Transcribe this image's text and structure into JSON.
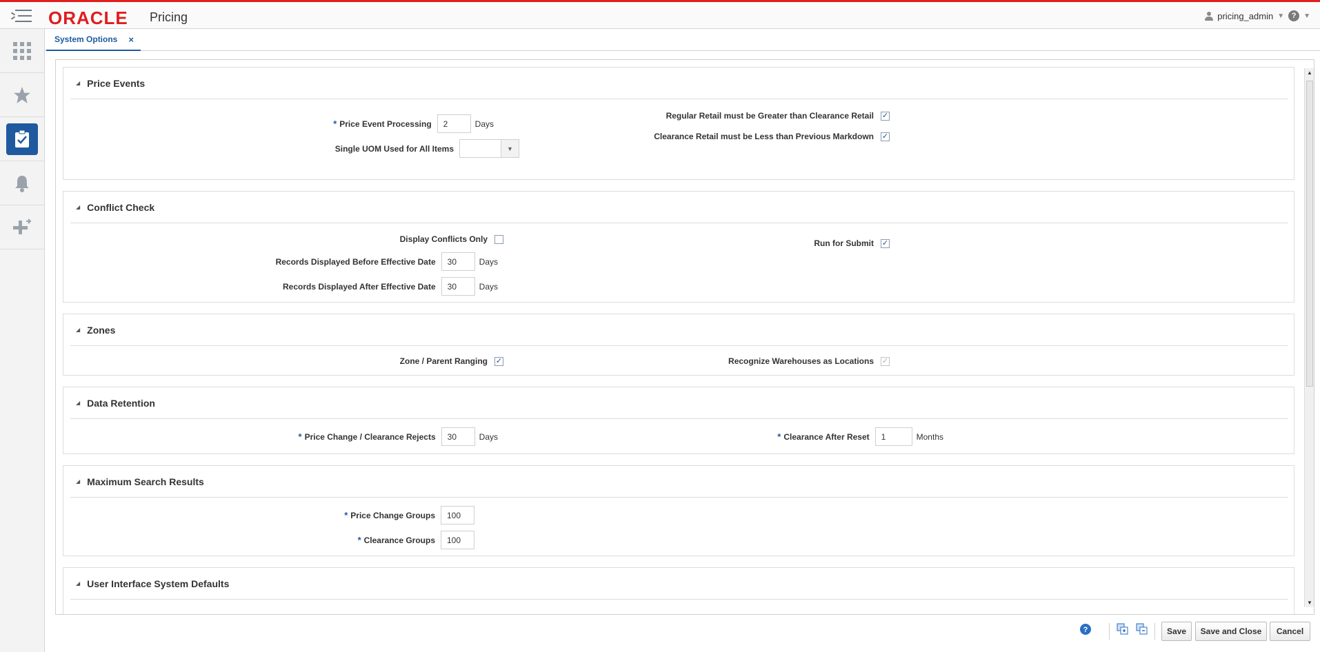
{
  "header": {
    "brand": "ORACLE",
    "app_name": "Pricing",
    "username": "pricing_admin",
    "help_glyph": "?"
  },
  "tabs": [
    {
      "label": "System Options",
      "close_glyph": "×"
    }
  ],
  "sections": {
    "price_events": {
      "title": "Price Events",
      "price_event_processing": {
        "label": "Price Event Processing",
        "value": "2",
        "unit": "Days"
      },
      "single_uom": {
        "label": "Single UOM Used for All Items",
        "value": ""
      },
      "regular_gt_clearance": {
        "label": "Regular Retail must be Greater than Clearance Retail",
        "checked": true
      },
      "clearance_lt_markdown": {
        "label": "Clearance Retail must be Less than Previous Markdown",
        "checked": true
      }
    },
    "conflict_check": {
      "title": "Conflict Check",
      "display_conflicts_only": {
        "label": "Display Conflicts Only",
        "checked": false
      },
      "records_before": {
        "label": "Records Displayed Before Effective Date",
        "value": "30",
        "unit": "Days"
      },
      "records_after": {
        "label": "Records Displayed After Effective Date",
        "value": "30",
        "unit": "Days"
      },
      "run_for_submit": {
        "label": "Run for Submit",
        "checked": true
      }
    },
    "zones": {
      "title": "Zones",
      "zone_parent_ranging": {
        "label": "Zone / Parent Ranging",
        "checked": true
      },
      "recognize_warehouses": {
        "label": "Recognize Warehouses as Locations",
        "checked": true
      }
    },
    "data_retention": {
      "title": "Data Retention",
      "price_change_rejects": {
        "label": "Price Change / Clearance Rejects",
        "value": "30",
        "unit": "Days"
      },
      "clearance_after_reset": {
        "label": "Clearance After Reset",
        "value": "1",
        "unit": "Months"
      }
    },
    "max_search": {
      "title": "Maximum Search Results",
      "price_change_groups": {
        "label": "Price Change Groups",
        "value": "100"
      },
      "clearance_groups": {
        "label": "Clearance Groups",
        "value": "100"
      }
    },
    "ui_defaults": {
      "title": "User Interface System Defaults"
    }
  },
  "required_marker": "*",
  "check_glyph": "✓",
  "footer": {
    "save": "Save",
    "save_close": "Save and Close",
    "cancel": "Cancel"
  }
}
